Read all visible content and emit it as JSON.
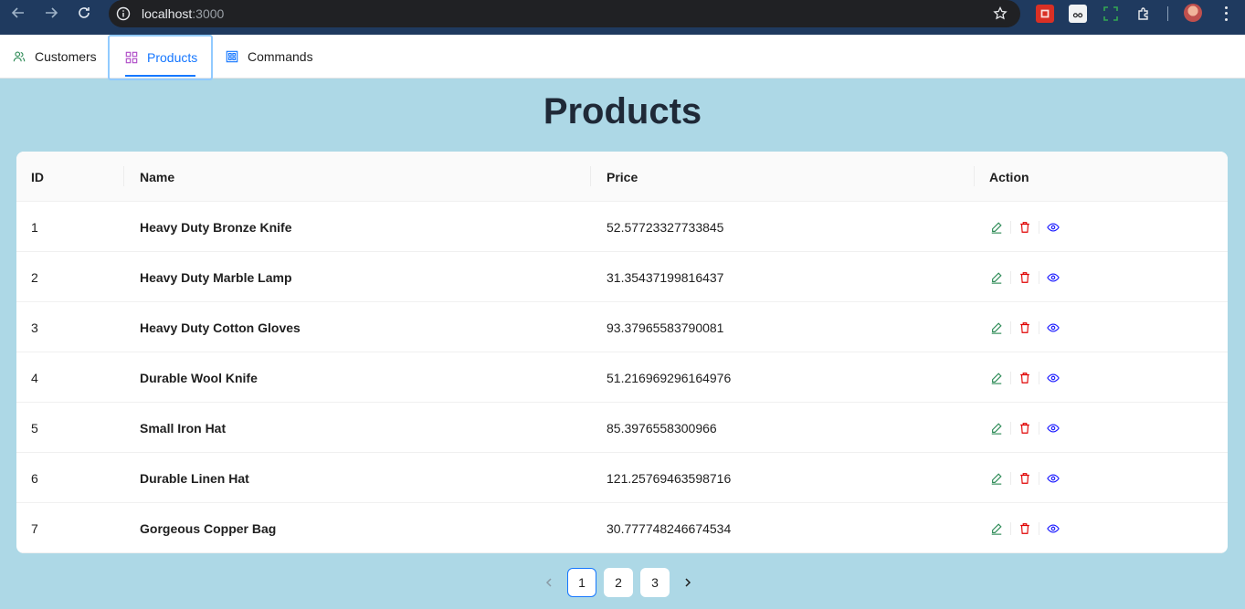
{
  "browser": {
    "url_host": "localhost",
    "url_port": ":3000"
  },
  "menu": {
    "items": [
      {
        "label": "Customers",
        "icon": "user-group-icon"
      },
      {
        "label": "Products",
        "icon": "appstore-icon",
        "active": true
      },
      {
        "label": "Commands",
        "icon": "grid-icon"
      }
    ]
  },
  "page": {
    "title": "Products"
  },
  "table": {
    "columns": [
      "ID",
      "Name",
      "Price",
      "Action"
    ],
    "rows": [
      {
        "id": "1",
        "name": "Heavy Duty Bronze Knife",
        "price": "52.57723327733845"
      },
      {
        "id": "2",
        "name": "Heavy Duty Marble Lamp",
        "price": "31.35437199816437"
      },
      {
        "id": "3",
        "name": "Heavy Duty Cotton Gloves",
        "price": "93.37965583790081"
      },
      {
        "id": "4",
        "name": "Durable Wool Knife",
        "price": "51.216969296164976"
      },
      {
        "id": "5",
        "name": "Small Iron Hat",
        "price": "85.3976558300966"
      },
      {
        "id": "6",
        "name": "Durable Linen Hat",
        "price": "121.25769463598716"
      },
      {
        "id": "7",
        "name": "Gorgeous Copper Bag",
        "price": "30.777748246674534"
      }
    ],
    "action_colors": {
      "edit": "#2e8b57",
      "delete": "#e00000",
      "view": "#1a1aff"
    }
  },
  "pagination": {
    "pages": [
      "1",
      "2",
      "3"
    ],
    "current": "1"
  },
  "colors": {
    "page_background": "#add8e6",
    "accent": "#1677ff"
  }
}
